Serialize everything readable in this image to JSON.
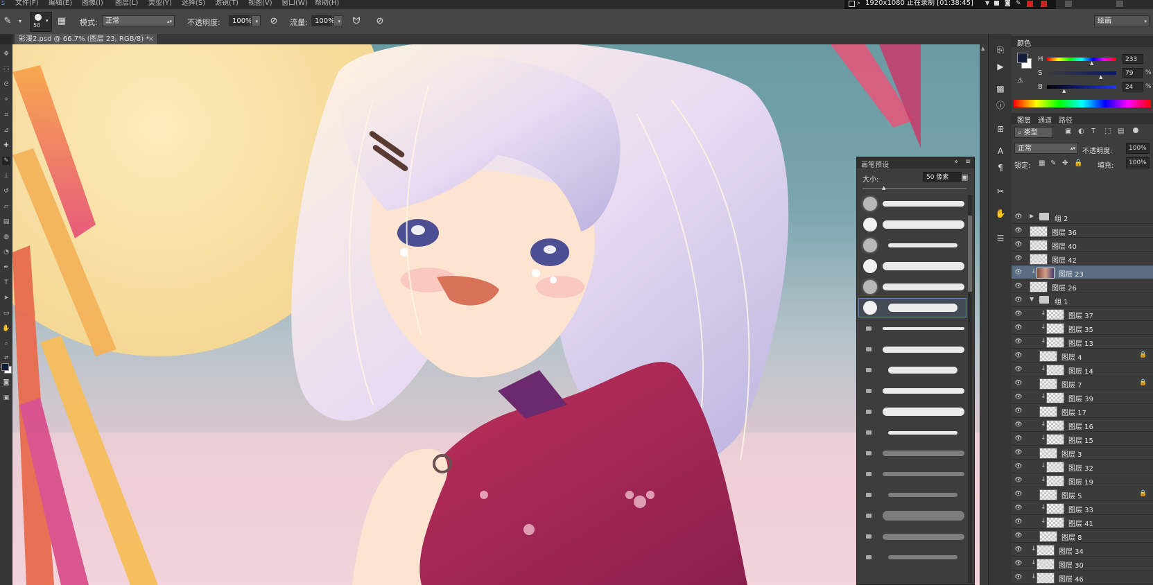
{
  "menu": [
    "文件(F)",
    "编辑(E)",
    "图像(I)",
    "图层(L)",
    "类型(Y)",
    "选择(S)",
    "滤镜(T)",
    "视图(V)",
    "窗口(W)",
    "帮助(H)"
  ],
  "recording": {
    "text": "1920x1080  正在录制 [01:38:45]"
  },
  "options": {
    "brush_size": "50",
    "mode_label": "模式:",
    "mode_value": "正常",
    "opacity_label": "不透明度:",
    "opacity_value": "100%",
    "flow_label": "流量:",
    "flow_value": "100%",
    "workspace": "绘画"
  },
  "document_tab": {
    "title": "彩漫2.psd @ 66.7% (图层 23, RGB/8) *",
    "close": "×"
  },
  "brush_panel": {
    "title": "画笔预设",
    "size_label": "大小:",
    "size_value": "50 像素",
    "brush_count": 18
  },
  "color_panel": {
    "tab": "颜色",
    "h_label": "H",
    "h_value": "233",
    "s_label": "S",
    "s_value": "79",
    "b_label": "B",
    "b_value": "24",
    "pct": "%",
    "foreground": "#141c3c",
    "background": "#ffffff"
  },
  "layers_panel": {
    "tabs": [
      "图层",
      "通道",
      "路径"
    ],
    "filter": "类型",
    "blend_mode": "正常",
    "opacity_label": "不透明度:",
    "opacity_value": "100%",
    "lock_label": "锁定:",
    "fill_label": "填充:",
    "fill_value": "100%",
    "layers": [
      {
        "name": "组 2",
        "kind": "group",
        "expanded": false
      },
      {
        "name": "图层 36",
        "kind": "layer"
      },
      {
        "name": "图层 40",
        "kind": "layer"
      },
      {
        "name": "图层 42",
        "kind": "layer"
      },
      {
        "name": "图层 23",
        "kind": "layer",
        "selected": true,
        "clipped": true
      },
      {
        "name": "图层 26",
        "kind": "layer"
      },
      {
        "name": "组 1",
        "kind": "group",
        "expanded": true
      },
      {
        "name": "图层 37",
        "kind": "layer",
        "clipped": true,
        "indent": true
      },
      {
        "name": "图层 35",
        "kind": "layer",
        "clipped": true,
        "indent": true
      },
      {
        "name": "图层 13",
        "kind": "layer",
        "clipped": true,
        "indent": true
      },
      {
        "name": "图层 4",
        "kind": "layer",
        "indent": true,
        "locked": true
      },
      {
        "name": "图层 14",
        "kind": "layer",
        "clipped": true,
        "indent": true
      },
      {
        "name": "图层 7",
        "kind": "layer",
        "indent": true,
        "locked": true
      },
      {
        "name": "图层 39",
        "kind": "layer",
        "clipped": true,
        "indent": true
      },
      {
        "name": "图层 17",
        "kind": "layer",
        "indent": true
      },
      {
        "name": "图层 16",
        "kind": "layer",
        "clipped": true,
        "indent": true
      },
      {
        "name": "图层 15",
        "kind": "layer",
        "clipped": true,
        "indent": true
      },
      {
        "name": "图层 3",
        "kind": "layer",
        "indent": true
      },
      {
        "name": "图层 32",
        "kind": "layer",
        "clipped": true,
        "indent": true
      },
      {
        "name": "图层 19",
        "kind": "layer",
        "clipped": true,
        "indent": true
      },
      {
        "name": "图层 5",
        "kind": "layer",
        "indent": true,
        "locked": true
      },
      {
        "name": "图层 33",
        "kind": "layer",
        "clipped": true,
        "indent": true
      },
      {
        "name": "图层 41",
        "kind": "layer",
        "clipped": true,
        "indent": true
      },
      {
        "name": "图层 8",
        "kind": "layer",
        "indent": true
      },
      {
        "name": "图层 34",
        "kind": "layer",
        "clipped": true
      },
      {
        "name": "图层 30",
        "kind": "layer",
        "clipped": true
      },
      {
        "name": "图层 46",
        "kind": "layer",
        "clipped": true
      }
    ]
  }
}
